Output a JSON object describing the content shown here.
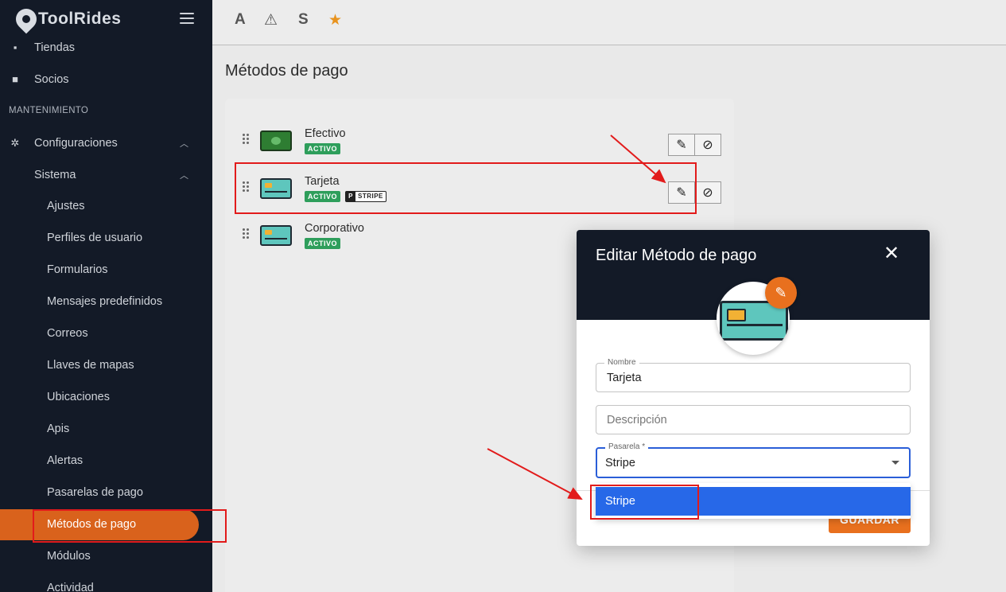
{
  "sidebar": {
    "brand": "ToolRides",
    "items": [
      {
        "label": "Tiendas",
        "icon": "store-icon"
      },
      {
        "label": "Socios",
        "icon": "briefcase-icon"
      }
    ],
    "section": "MANTENIMIENTO",
    "config": {
      "label": "Configuraciones",
      "icon": "gear-icon"
    },
    "sistema": {
      "label": "Sistema"
    },
    "subitems": [
      "Ajustes",
      "Perfiles de usuario",
      "Formularios",
      "Mensajes predefinidos",
      "Correos",
      "Llaves de mapas",
      "Ubicaciones",
      "Apis",
      "Alertas",
      "Pasarelas de pago",
      "Métodos de pago",
      "Módulos",
      "Actividad"
    ]
  },
  "topbar": {
    "icons": [
      "A",
      "⚠",
      "S",
      "★"
    ]
  },
  "page": {
    "title": "Métodos de pago"
  },
  "payment_methods": [
    {
      "name": "Efectivo",
      "status": "ACTIVO",
      "gateway": ""
    },
    {
      "name": "Tarjeta",
      "status": "ACTIVO",
      "gateway": "STRIPE"
    },
    {
      "name": "Corporativo",
      "status": "ACTIVO",
      "gateway": ""
    }
  ],
  "modal": {
    "title": "Editar Método de pago",
    "close": "✕",
    "name_label": "Nombre",
    "name_value": "Tarjeta",
    "description_placeholder": "Descripción",
    "gateway_label": "Pasarela *",
    "gateway_value": "Stripe",
    "save_label": "GUARDAR",
    "dropdown_options": [
      "Stripe"
    ]
  },
  "colors": {
    "accent": "#e8701e",
    "sidebar_bg": "#131a27",
    "active_badge": "#2e9e5b",
    "selection": "#2768e8"
  }
}
